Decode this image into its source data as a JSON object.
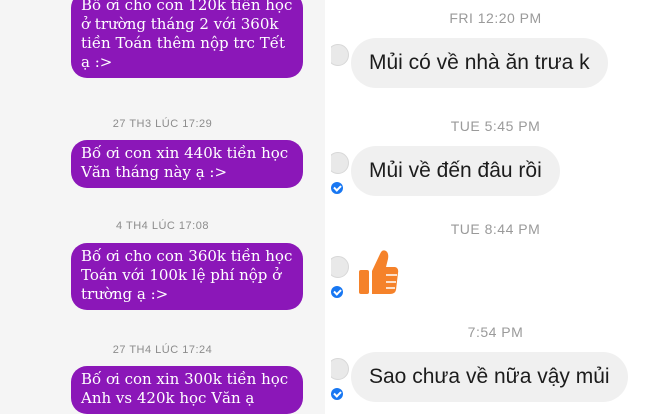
{
  "left_chat": {
    "messages": [
      {
        "lines": [
          "Bố ơi cho con 120k tiền học",
          "ở trường tháng 2 với 360k",
          "tiền Toán thêm nộp trc Tết",
          "ạ :>"
        ]
      },
      {
        "timestamp": "27 TH3 LÚC 17:29",
        "lines": [
          "Bố ơi con xin 440k tiền học",
          "Văn tháng này ạ :>"
        ]
      },
      {
        "timestamp": "4 TH4 LÚC 17:08",
        "lines": [
          "Bố ơi cho con 360k tiền học",
          "Toán với 100k lệ phí nộp ở",
          "trường ạ :>"
        ]
      },
      {
        "timestamp": "27 TH4 LÚC 17:24",
        "lines": [
          "Bố ơi con xin 300k tiền học",
          "Anh vs 420k học Văn ạ"
        ]
      }
    ]
  },
  "right_chat": {
    "items": [
      {
        "timestamp": "FRI 12:20 PM",
        "message": "Mủi có về nhà ăn trưa k"
      },
      {
        "timestamp": "TUE 5:45 PM",
        "message": "Mủi về đến đâu rồi"
      },
      {
        "timestamp": "TUE 8:44 PM",
        "reaction_icon": "thumbs-up-icon"
      },
      {
        "timestamp": "7:54 PM",
        "message": "Sao chưa về nữa vậy mủi"
      }
    ]
  },
  "colors": {
    "left_bubble": "#8b17b8",
    "right_bubble": "#f0f0f0",
    "like": "#f5822a",
    "seen": "#1877f2"
  }
}
